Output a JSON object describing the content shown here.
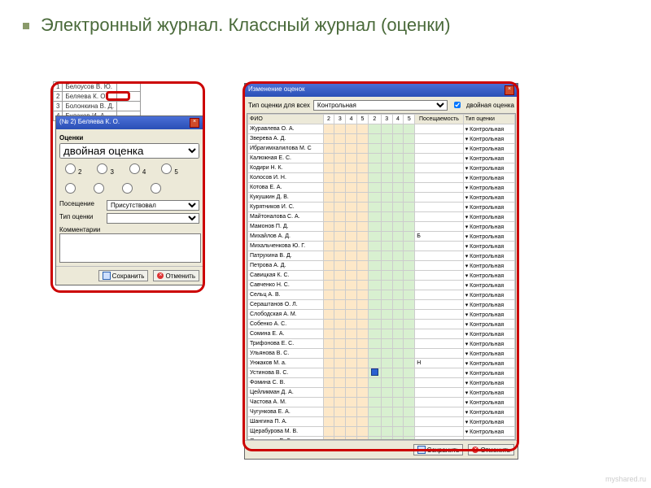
{
  "title": "Электронный журнал. Классный журнал (оценки)",
  "bg_students": [
    {
      "n": "1",
      "name": "Белоусов В. Ю."
    },
    {
      "n": "2",
      "name": "Беляева К. О."
    },
    {
      "n": "3",
      "name": "Болонкина В. Д."
    },
    {
      "n": "4",
      "name": "Булаков И. А."
    }
  ],
  "left": {
    "title": "(№ 2) Беляева К. О.",
    "grades_label": "Оценки",
    "double_label": "двойная оценка",
    "nums": [
      "2",
      "3",
      "4",
      "5"
    ],
    "attendance_label": "Посещение",
    "attendance_value": "Присутствовал",
    "type_label": "Тип оценки",
    "comment_label": "Комментарии",
    "save": "Сохранить",
    "cancel": "Отменить"
  },
  "right": {
    "title": "Изменение оценок",
    "type_for_all": "Тип оценки для всех",
    "type_value": "Контрольная",
    "double_check": "двойная оценка",
    "headers": {
      "fio": "ФИО",
      "nums": [
        "2",
        "3",
        "4",
        "5",
        "2",
        "3",
        "4",
        "5"
      ],
      "att": "Посещаемость",
      "typ": "Тип оценки"
    },
    "rows": [
      {
        "fio": "Журавлева О. А.",
        "att": "",
        "typ": "Контрольная"
      },
      {
        "fio": "Зверева А. Д.",
        "att": "",
        "typ": "Контрольная"
      },
      {
        "fio": "Ибрагимхалилова М. С",
        "att": "",
        "typ": "Контрольная"
      },
      {
        "fio": "Калюжная Е. С.",
        "att": "",
        "typ": "Контрольная"
      },
      {
        "fio": "Кодири Н. К.",
        "att": "",
        "typ": "Контрольная"
      },
      {
        "fio": "Колосов И. Н.",
        "att": "",
        "typ": "Контрольная"
      },
      {
        "fio": "Котова Е. А.",
        "att": "",
        "typ": "Контрольная"
      },
      {
        "fio": "Кукушкин Д. В.",
        "att": "",
        "typ": "Контрольная"
      },
      {
        "fio": "Курятников И. С.",
        "att": "",
        "typ": "Контрольная"
      },
      {
        "fio": "Майтоналова С. А.",
        "att": "",
        "typ": "Контрольная"
      },
      {
        "fio": "Мамонов П. Д.",
        "att": "",
        "typ": "Контрольная"
      },
      {
        "fio": "Михайлов А. Д.",
        "att": "Б",
        "typ": "Контрольная"
      },
      {
        "fio": "Михальченкова Ю. Г.",
        "att": "",
        "typ": "Контрольная"
      },
      {
        "fio": "Патрухина В. Д.",
        "att": "",
        "typ": "Контрольная"
      },
      {
        "fio": "Петрова А. Д.",
        "att": "",
        "typ": "Контрольная"
      },
      {
        "fio": "Савицкая К. С.",
        "att": "",
        "typ": "Контрольная"
      },
      {
        "fio": "Савченко Н. С.",
        "att": "",
        "typ": "Контрольная"
      },
      {
        "fio": "Сельц А. В.",
        "att": "",
        "typ": "Контрольная"
      },
      {
        "fio": "Сераштанов О. Л.",
        "att": "",
        "typ": "Контрольная"
      },
      {
        "fio": "Слободская А. М.",
        "att": "",
        "typ": "Контрольная"
      },
      {
        "fio": "Собенко А. С.",
        "att": "",
        "typ": "Контрольная"
      },
      {
        "fio": "Сомина Е. А.",
        "att": "",
        "typ": "Контрольная"
      },
      {
        "fio": "Трифонова Е. С.",
        "att": "",
        "typ": "Контрольная"
      },
      {
        "fio": "Ульянова В. С.",
        "att": "",
        "typ": "Контрольная"
      },
      {
        "fio": "Унжаков М. а.",
        "att": "Н",
        "typ": "Контрольная"
      },
      {
        "fio": "Устинова В. С.",
        "att": "",
        "typ": "Контрольная",
        "chk": true
      },
      {
        "fio": "Фомина С. В.",
        "att": "",
        "typ": "Контрольная"
      },
      {
        "fio": "Цейликман Д. А.",
        "att": "",
        "typ": "Контрольная"
      },
      {
        "fio": "Частова А. М.",
        "att": "",
        "typ": "Контрольная"
      },
      {
        "fio": "Чугункова Е. А.",
        "att": "",
        "typ": "Контрольная"
      },
      {
        "fio": "Шангина П. А.",
        "att": "",
        "typ": "Контрольная"
      },
      {
        "fio": "Щерабурова М. В.",
        "att": "",
        "typ": "Контрольная"
      },
      {
        "fio": "Янюшкина Е. С.",
        "att": "",
        "typ": "Контрольная"
      }
    ],
    "save": "Сохранить",
    "cancel": "Отменить"
  },
  "watermark": "myshared.ru"
}
